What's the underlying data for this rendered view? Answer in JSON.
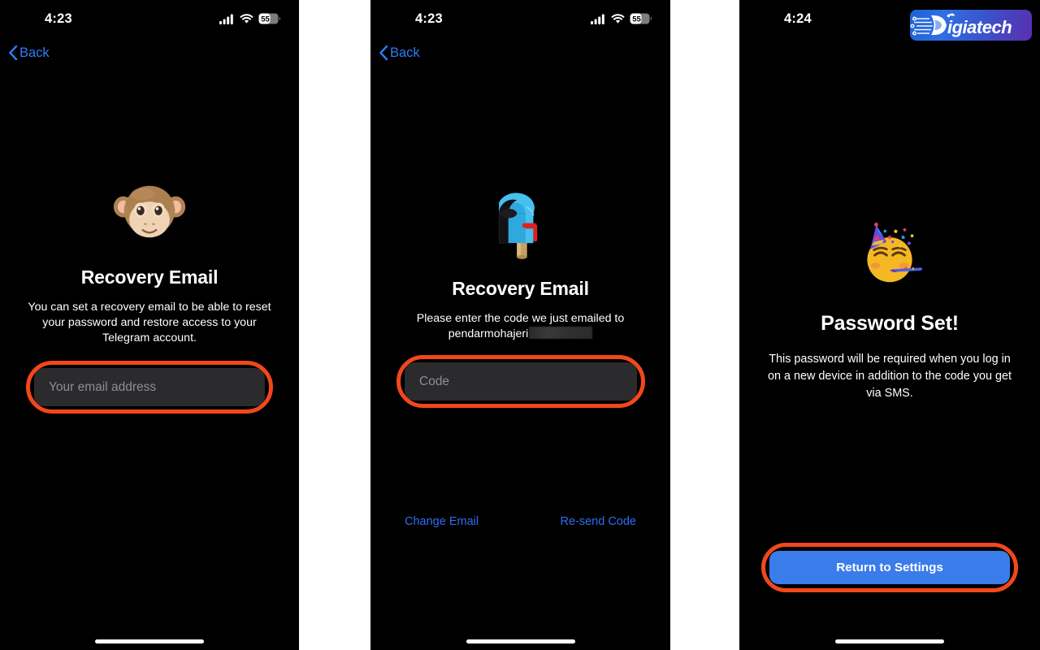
{
  "meta": {
    "app": "Telegram",
    "platform": "iOS",
    "gap_color": "#ffffff",
    "screen_bg": "#000000"
  },
  "colors": {
    "accent_blue": "#2f7bf5",
    "link_blue": "#2f6ef0",
    "button_blue": "#3b7ceb",
    "highlight_ring": "#f2471c",
    "field_bg": "#2b2b2d",
    "placeholder": "#8e8e93",
    "text_primary": "#ffffff"
  },
  "panels": [
    {
      "id": "recovery-email-entry",
      "status_bar": {
        "time": "4:23",
        "cellular_icon": "cellular-bars-icon",
        "wifi_icon": "wifi-icon",
        "battery_icon": "battery-icon",
        "battery_level": "55"
      },
      "nav": {
        "back_label": "Back",
        "back_icon": "chevron-left-icon"
      },
      "hero_icon": "monkey-face-emoji",
      "title": "Recovery Email",
      "description": "You can set a recovery email to be able to reset your password and restore access to your Telegram account.",
      "field": {
        "name": "email-input",
        "placeholder": "Your email address",
        "value": "",
        "highlighted": true
      }
    },
    {
      "id": "recovery-email-code",
      "status_bar": {
        "time": "4:23",
        "cellular_icon": "cellular-bars-icon",
        "wifi_icon": "wifi-icon",
        "battery_icon": "battery-icon",
        "battery_level": "55"
      },
      "nav": {
        "back_label": "Back",
        "back_icon": "chevron-left-icon"
      },
      "hero_icon": "mailbox-emoji",
      "title": "Recovery Email",
      "description_line1": "Please enter the code we just emailed to",
      "description_email_visible": "pendarmohajeri",
      "description_email_redacted": true,
      "field": {
        "name": "code-input",
        "placeholder": "Code",
        "value": "",
        "highlighted": true
      },
      "links": {
        "change_email": "Change Email",
        "resend_code": "Re-send Code"
      }
    },
    {
      "id": "password-set-success",
      "status_bar": {
        "time": "4:24",
        "cellular_icon": null,
        "wifi_icon": null,
        "battery_icon": null,
        "battery_level": null
      },
      "watermark": {
        "text": "igiatech",
        "initial": "D",
        "name": "digiatech-logo"
      },
      "hero_icon": "partying-face-emoji",
      "title": "Password Set!",
      "description": "This password will be required when you log in on a new device in addition to the code you get via SMS.",
      "primary_button": {
        "label": "Return to Settings",
        "highlighted": true
      }
    }
  ]
}
